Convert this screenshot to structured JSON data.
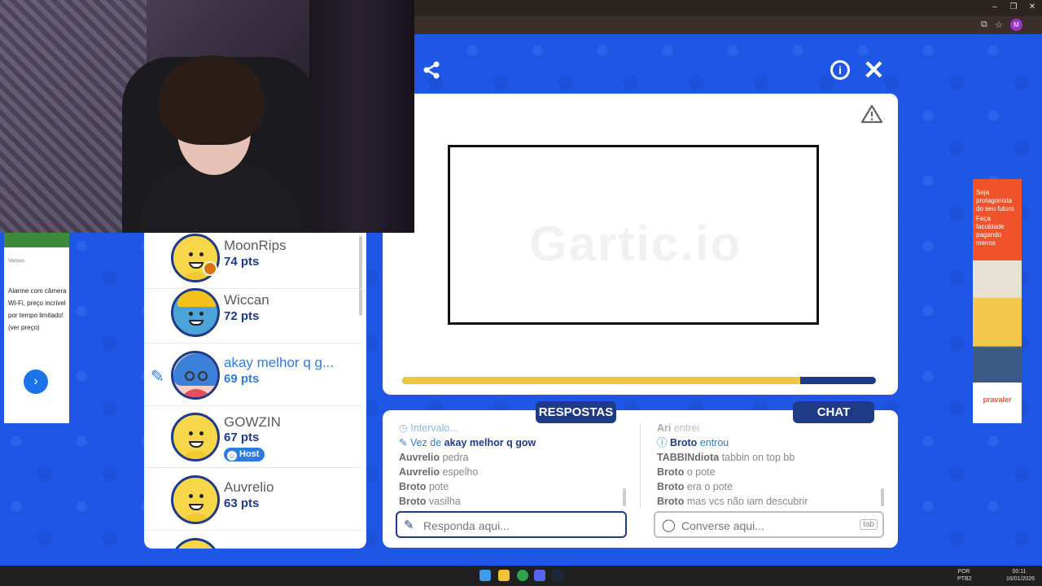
{
  "browser": {
    "window_controls": [
      "–",
      "❐",
      "✕"
    ],
    "avatar_letter": "M"
  },
  "left_ad": {
    "brand": "Various",
    "text": "Alarme com câmera Wi-Fi, preço incrível por tempo limitado! (ver preço)",
    "button": "›"
  },
  "players": [
    {
      "name": "MoonRips",
      "pts": "74 pts"
    },
    {
      "name": "Wiccan",
      "pts": "72 pts"
    },
    {
      "name": "akay melhor q g...",
      "pts": "69 pts",
      "drawing": true
    },
    {
      "name": "GOWZIN",
      "pts": "67 pts",
      "host": "Host"
    },
    {
      "name": "Auvrelio",
      "pts": "63 pts"
    }
  ],
  "canvas": {
    "watermark": "Gartic.io",
    "timer_progress": 0.84
  },
  "tabs": {
    "answers": "RESPOSTAS",
    "chat": "CHAT"
  },
  "answers": [
    {
      "user": "",
      "text": "Intervalo...",
      "type": "system"
    },
    {
      "user": "akay melhor q gow",
      "prefix": "Vez de ",
      "type": "turn"
    },
    {
      "user": "Auvrelio",
      "text": "pedra"
    },
    {
      "user": "Auvrelio",
      "text": "espelho"
    },
    {
      "user": "Broto",
      "text": "pote"
    },
    {
      "user": "Broto",
      "text": "vasilha"
    }
  ],
  "chat": [
    {
      "user": "Ari",
      "text": "entrei"
    },
    {
      "user": "Broto",
      "text": "entrou",
      "type": "system"
    },
    {
      "user": "TABBINdiota",
      "text": "tabbin on top bb"
    },
    {
      "user": "Broto",
      "text": "o pote"
    },
    {
      "user": "Broto",
      "text": "era o pote"
    },
    {
      "user": "Broto",
      "text": "mas vcs não iam descubrir"
    }
  ],
  "inputs": {
    "answer_placeholder": "Responda aqui...",
    "chat_placeholder": "Converse aqui...",
    "chat_shortcut": "tab"
  },
  "right_ad": {
    "headline": "Seja protagonista do seu futuro",
    "sub": "Faça faculdade pagando menos",
    "logo": "pravaler"
  },
  "taskbar": {
    "lang": "POR",
    "layout": "PTB2",
    "time": "00:11",
    "date": "16/01/2026"
  },
  "colors": {
    "background": "#1e56e6",
    "navy": "#1f3b88",
    "accent_blue": "#2e7be0",
    "timer": "#f0c542"
  }
}
